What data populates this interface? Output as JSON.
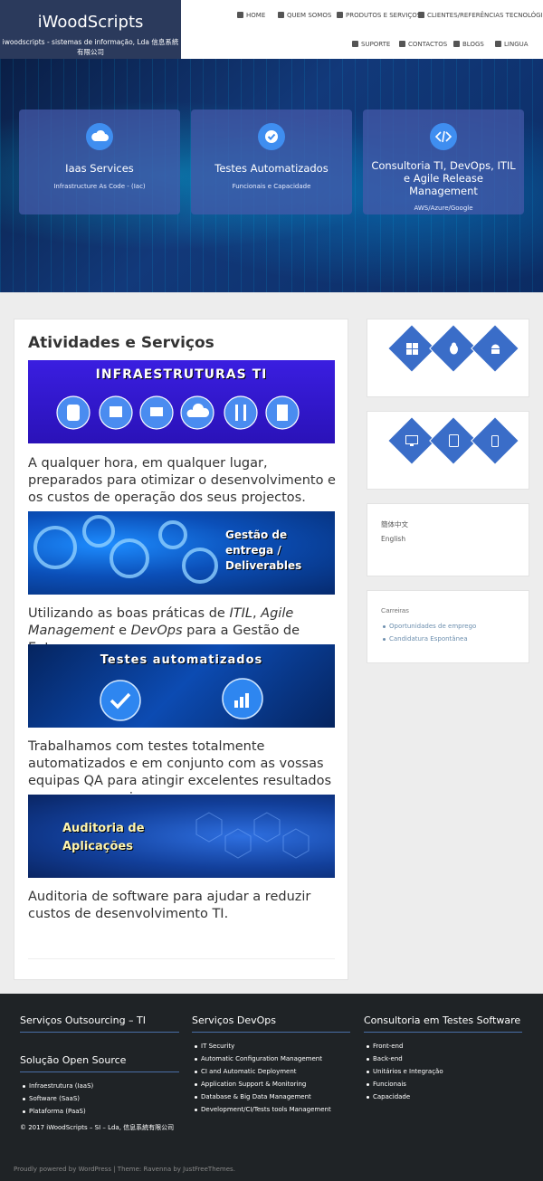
{
  "brand": {
    "title": "iWoodScripts",
    "subtitle": "iwoodscripts - sistemas de informação, Lda 信息系統有限公司"
  },
  "nav": {
    "home": "HOME",
    "quem": "QUEM SOMOS",
    "produtos": "PRODUTOS E SERVIÇOS",
    "clientes": "CLIENTES/REFERÊNCIAS TECNOLÓGICAS",
    "suporte": "SUPORTE",
    "contactos": "CONTACTOS",
    "blogs": "BLOGS",
    "lingua": "LINGUA"
  },
  "hero": {
    "cards": [
      {
        "title": "Iaas Services",
        "subtitle": "Infrastructure As Code - (Iac)",
        "icon": "cloud-icon"
      },
      {
        "title": "Testes Automatizados",
        "subtitle": "Funcionais e Capacidade",
        "icon": "check-icon"
      },
      {
        "title": "Consultoria TI, DevOps, ITIL e Agile Release Management",
        "subtitle": "AWS/Azure/Google",
        "icon": "code-icon"
      }
    ]
  },
  "main": {
    "title": "Atividades e Serviços",
    "banner1": "INFRAESTRUTURAS TI",
    "text1": "A qualquer hora, em qualquer lugar, preparados para otimizar o desenvolvimento e os custos de operação dos seus projectos.",
    "banner2a": "Gestão de",
    "banner2b": "entrega /",
    "banner2c": "Deliverables",
    "text2a": "Utilizando as boas práticas de ",
    "text2b": "ITIL",
    "text2c": ", ",
    "text2d": "Agile Management",
    "text2e": " e ",
    "text2f": "DevOps",
    "text2g": " para a Gestão de Entregas.",
    "banner3": "Testes automatizados",
    "text3": "Trabalhamos com testes totalmente automatizados e em conjunto com as vossas equipas QA para atingir excelentes resultados e sucesso ongoing.",
    "banner4a": "Auditoria de",
    "banner4b": "Aplicações",
    "text4": "Auditoria de software para ajudar a reduzir custos de desenvolvimento TI."
  },
  "sidebar": {
    "lang1": "簡体中文",
    "lang2": "English",
    "careers_title": "Carreiras",
    "careers": [
      "Oportunidades de emprego",
      "Candidatura Espontânea"
    ]
  },
  "footer": {
    "col1_title": "Serviços Outsourcing – TI",
    "col1b_title": "Solução Open Source",
    "col1b_items": [
      "Infraestrutura (IaaS)",
      "Software (SaaS)",
      "Plataforma (PaaS)"
    ],
    "copyright": "© 2017 iWoodScripts – SI – Lda, 信息系統有限公司",
    "col2_title": "Serviços DevOps",
    "col2_items": [
      "IT Security",
      "Automatic Configuration Management",
      "CI and Automatic Deployment",
      "Application Support & Monitoring",
      "Database & Big Data Management",
      "Development/CI/Tests tools Management"
    ],
    "col3_title": "Consultoria em Testes Software",
    "col3_items": [
      "Front-end",
      "Back-end",
      "Unitários e Integração",
      "Funcionais",
      "Capacidade"
    ],
    "powered": "Proudly powered by WordPress | Theme: Ravenna by JustFreeThemes."
  },
  "colors": {
    "brand": "#2b3a5c",
    "accent": "#3a6dc8",
    "footer": "#1f2326"
  }
}
